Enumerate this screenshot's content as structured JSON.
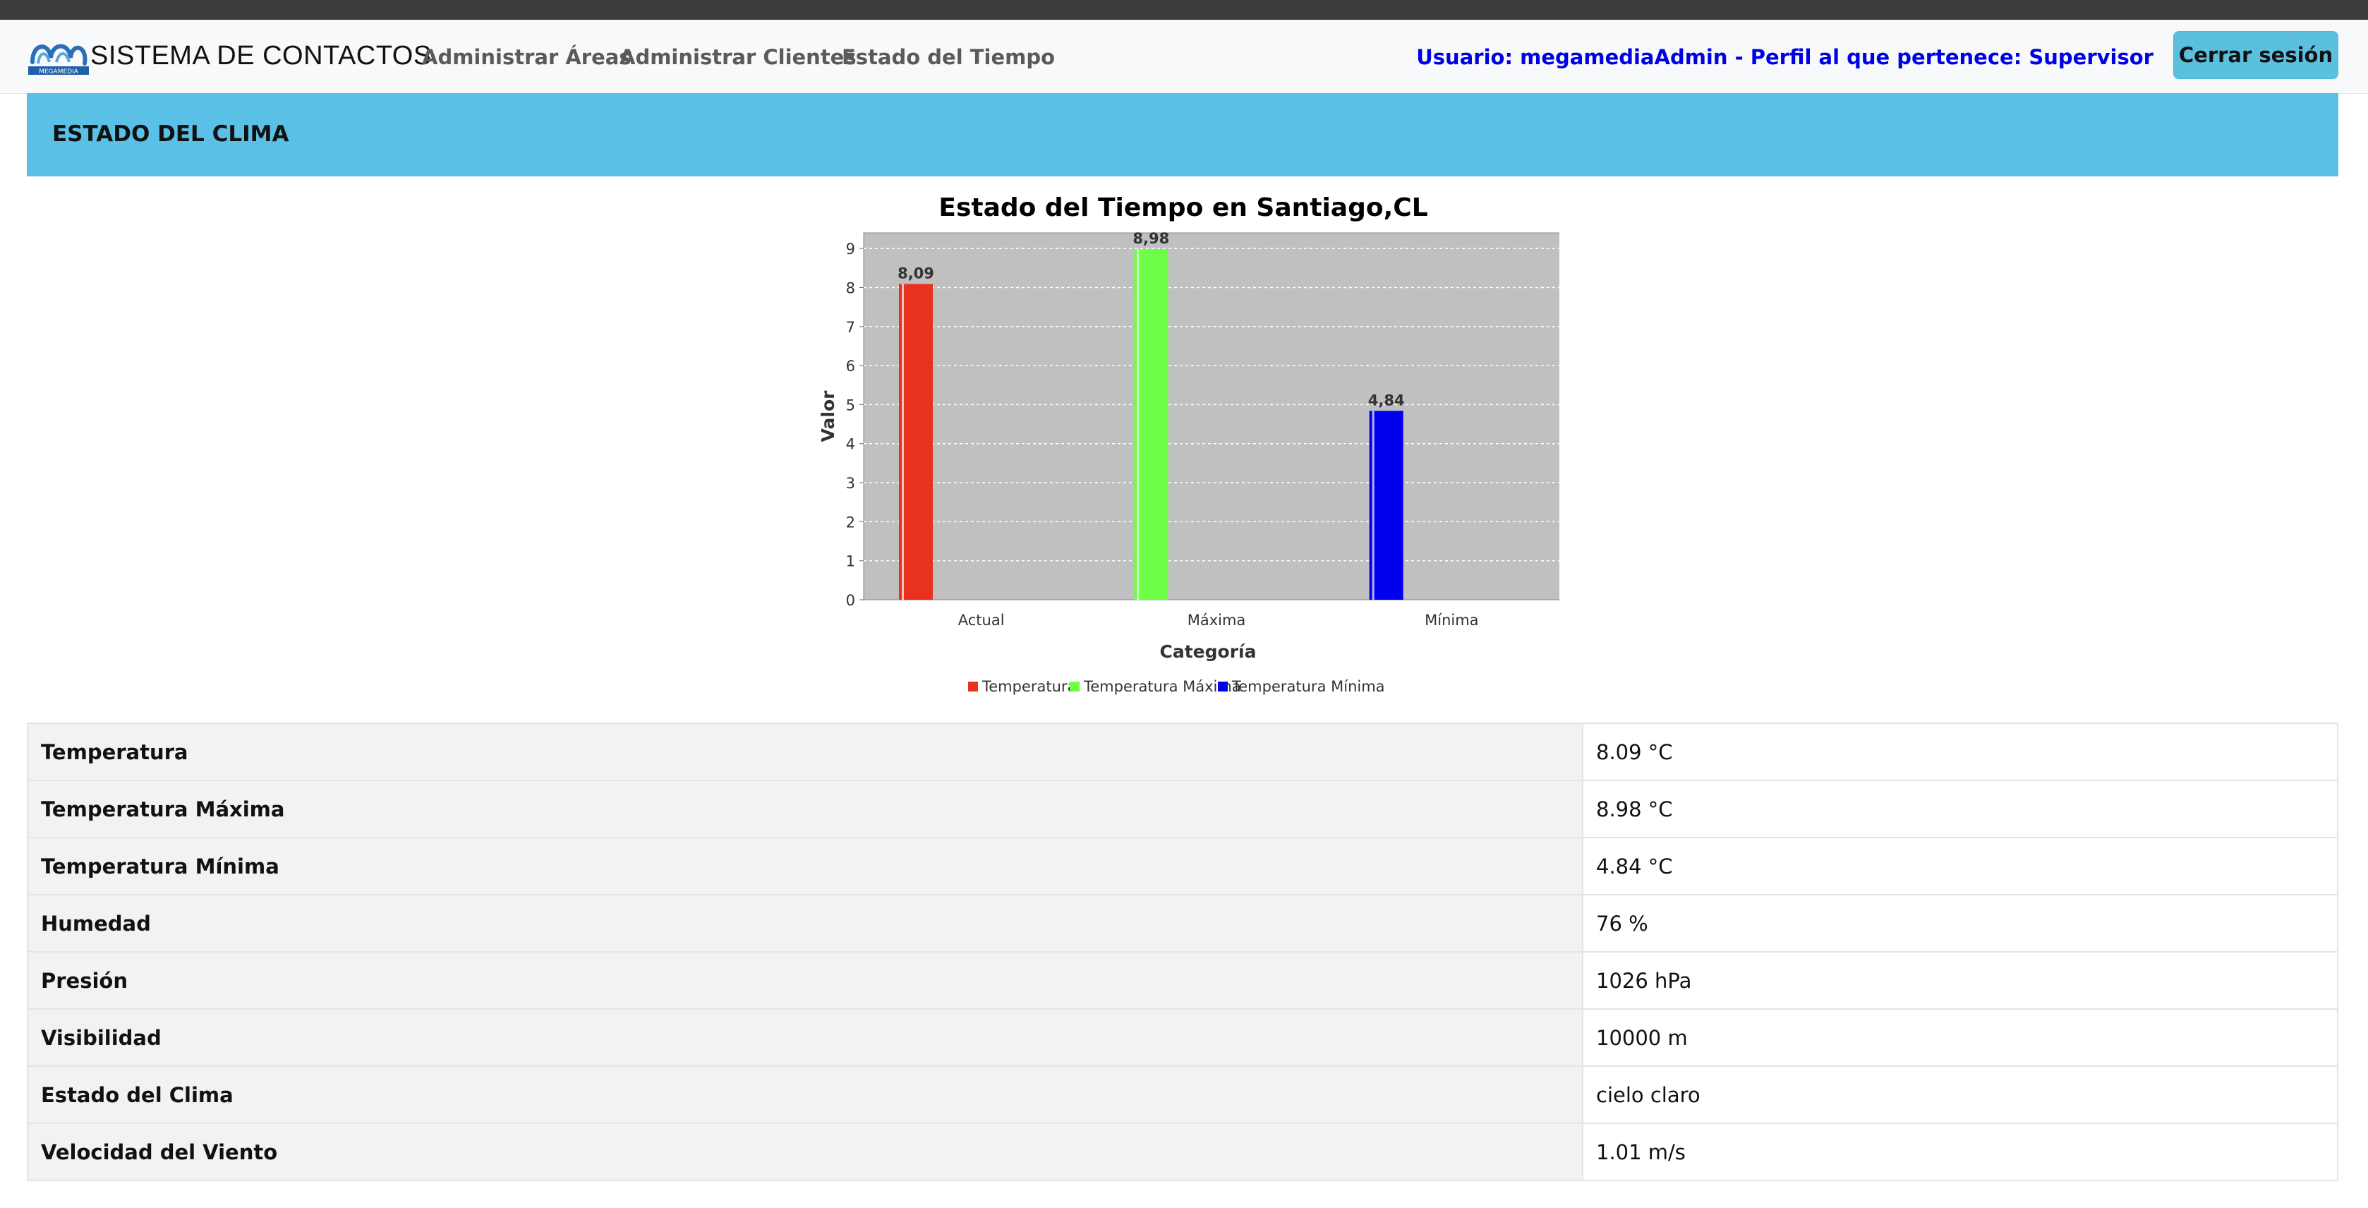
{
  "navbar": {
    "brand": "SISTEMA DE CONTACTOS",
    "logo_text": "MEGAMEDIA",
    "links": [
      "Administrar Áreas",
      "Administrar Clientes",
      "Estado del Tiempo"
    ],
    "user_info": "Usuario: megamediaAdmin - Perfil al que pertenece: Supervisor",
    "logout_label": "Cerrar sesión"
  },
  "banner": {
    "title": "ESTADO DEL CLIMA"
  },
  "chart_data": {
    "type": "bar",
    "title": "Estado del Tiempo en Santiago,CL",
    "xlabel": "Categoría",
    "ylabel": "Valor",
    "categories": [
      "Actual",
      "Máxima",
      "Mínima"
    ],
    "series": [
      {
        "name": "Temperatura",
        "category": "Actual",
        "value": 8.09,
        "label": "8,09",
        "color": "#e8311f"
      },
      {
        "name": "Temperatura Máxima",
        "category": "Máxima",
        "value": 8.98,
        "label": "8,98",
        "color": "#6cff46"
      },
      {
        "name": "Temperatura Mínima",
        "category": "Mínima",
        "value": 4.84,
        "label": "4,84",
        "color": "#0000ee"
      }
    ],
    "ylim": [
      0,
      9.4
    ],
    "yticks": [
      "0",
      "1",
      "2",
      "3",
      "4",
      "5",
      "6",
      "7",
      "8",
      "9"
    ],
    "grid": true,
    "legend": "bottom",
    "plot_background": "#c0c0c0"
  },
  "table": {
    "rows": [
      {
        "label": "Temperatura",
        "value": "8.09 °C"
      },
      {
        "label": "Temperatura Máxima",
        "value": "8.98 °C"
      },
      {
        "label": "Temperatura Mínima",
        "value": "4.84 °C"
      },
      {
        "label": "Humedad",
        "value": "76 %"
      },
      {
        "label": "Presión",
        "value": "1026 hPa"
      },
      {
        "label": "Visibilidad",
        "value": "10000 m"
      },
      {
        "label": "Estado del Clima",
        "value": "cielo claro"
      },
      {
        "label": "Velocidad del Viento",
        "value": "1.01 m/s"
      }
    ]
  },
  "colors": {
    "accent": "#5bc0de",
    "user_text": "#0000e6",
    "banner": "#5bc0e6"
  }
}
